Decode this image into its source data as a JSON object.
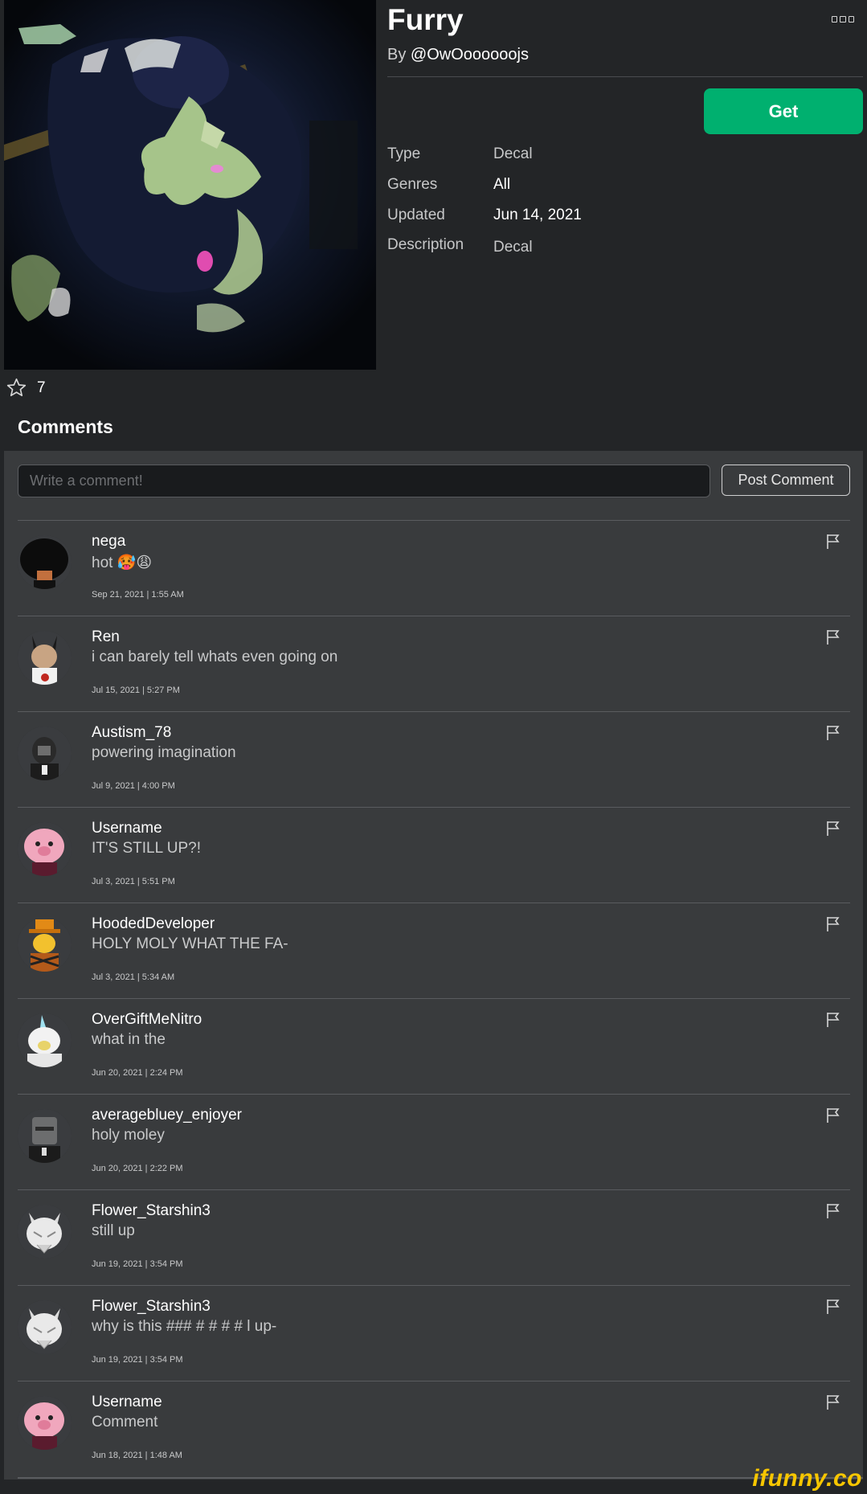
{
  "item": {
    "title": "Furry",
    "by_prefix": "By",
    "creator": "@OwOoooooojs",
    "get_label": "Get",
    "details": [
      {
        "key": "Type",
        "value": "Decal",
        "emphasis": false
      },
      {
        "key": "Genres",
        "value": "All",
        "emphasis": true
      },
      {
        "key": "Updated",
        "value": "Jun 14, 2021",
        "emphasis": true
      },
      {
        "key": "Description",
        "value": "Decal",
        "emphasis": false
      }
    ],
    "favorites": "7"
  },
  "comments_section": {
    "title": "Comments",
    "input_placeholder": "Write a comment!",
    "post_label": "Post Comment",
    "items": [
      {
        "user": "nega",
        "text": "hot 🥵😩",
        "date": "Sep 21, 2021 | 1:55 AM",
        "avatar": "black-hair-avatar"
      },
      {
        "user": "Ren",
        "text": "i can barely tell whats even going on",
        "date": "Jul 15, 2021 | 5:27 PM",
        "avatar": "horned-avatar"
      },
      {
        "user": "Austism_78",
        "text": "powering imagination",
        "date": "Jul 9, 2021 | 4:00 PM",
        "avatar": "gorilla-avatar"
      },
      {
        "user": "Username",
        "text": "IT'S STILL UP?!",
        "date": "Jul 3, 2021 | 5:51 PM",
        "avatar": "pink-pig-avatar"
      },
      {
        "user": "HoodedDeveloper",
        "text": "HOLY MOLY WHAT THE FA-",
        "date": "Jul 3, 2021 | 5:34 AM",
        "avatar": "orange-hat-avatar"
      },
      {
        "user": "OverGiftMeNitro",
        "text": "what in the",
        "date": "Jun 20, 2021 | 2:24 PM",
        "avatar": "white-unicorn-avatar"
      },
      {
        "user": "averagebluey_enjoyer",
        "text": "holy moley",
        "date": "Jun 20, 2021 | 2:22 PM",
        "avatar": "bucket-helmet-avatar"
      },
      {
        "user": "Flower_Starshin3",
        "text": "still up",
        "date": "Jun 19, 2021 | 3:54 PM",
        "avatar": "white-wolf-avatar"
      },
      {
        "user": "Flower_Starshin3",
        "text": "why is this ### # # # # l up-",
        "date": "Jun 19, 2021 | 3:54 PM",
        "avatar": "white-wolf-avatar"
      },
      {
        "user": "Username",
        "text": "Comment",
        "date": "Jun 18, 2021 | 1:48 AM",
        "avatar": "pink-pig-avatar"
      }
    ]
  },
  "watermark": "ifunny.co",
  "colors": {
    "background": "#232527",
    "panel": "#393b3d",
    "get_button": "#00b06f",
    "watermark": "#f7c600"
  }
}
